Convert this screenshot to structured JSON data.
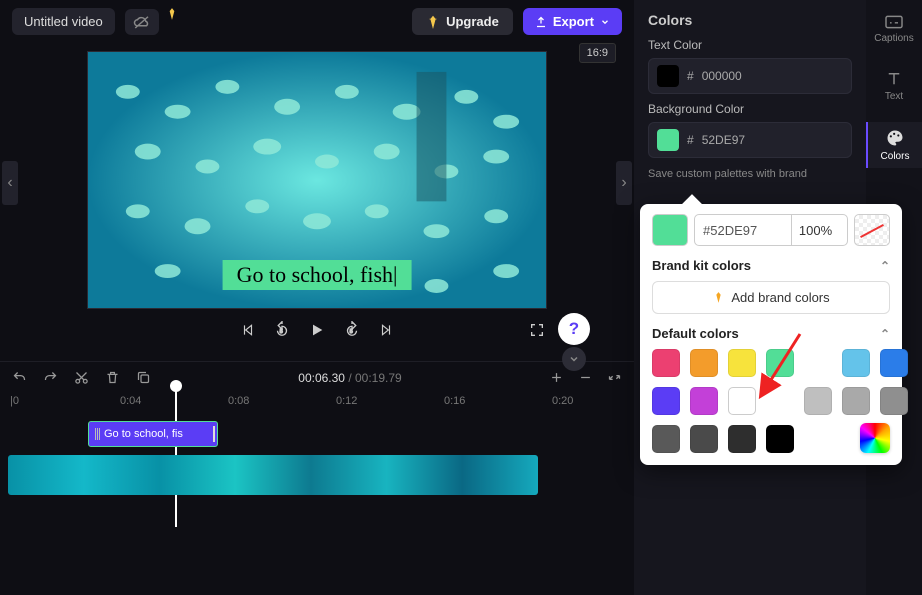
{
  "topbar": {
    "title": "Untitled video",
    "upgrade_label": "Upgrade",
    "export_label": "Export"
  },
  "preview": {
    "aspect": "16:9",
    "caption_text": "Go to school, fish",
    "help": "?"
  },
  "timeline": {
    "current_time": "00:06.30",
    "total_time": "00:19.79",
    "ticks": [
      "|0",
      "0:04",
      "0:08",
      "0:12",
      "0:16",
      "0:20"
    ],
    "text_clip_label": "Go to school, fis"
  },
  "side": {
    "heading": "Colors",
    "text_color_label": "Text Color",
    "text_color_hex": "000000",
    "bg_color_label": "Background Color",
    "bg_color_hex": "52DE97",
    "tip": "Save custom palettes with brand"
  },
  "popover": {
    "hex_input": "#52DE97",
    "opacity": "100%",
    "brand_heading": "Brand kit colors",
    "add_brand_label": "Add brand colors",
    "default_heading": "Default colors",
    "default_colors": [
      "#ec4071",
      "#f39c2b",
      "#f7e33c",
      "#52de97",
      "#64c3ea",
      "#2b7de9",
      "#5b3df5",
      "#c340d8",
      "#ffffff",
      "#bfbfbf",
      "#a9a9a9",
      "#8f8f8f",
      "#595959",
      "#4a4a4a",
      "#2e2e2e",
      "#000000"
    ]
  },
  "tabs": {
    "captions": "Captions",
    "text": "Text",
    "colors": "Colors"
  }
}
